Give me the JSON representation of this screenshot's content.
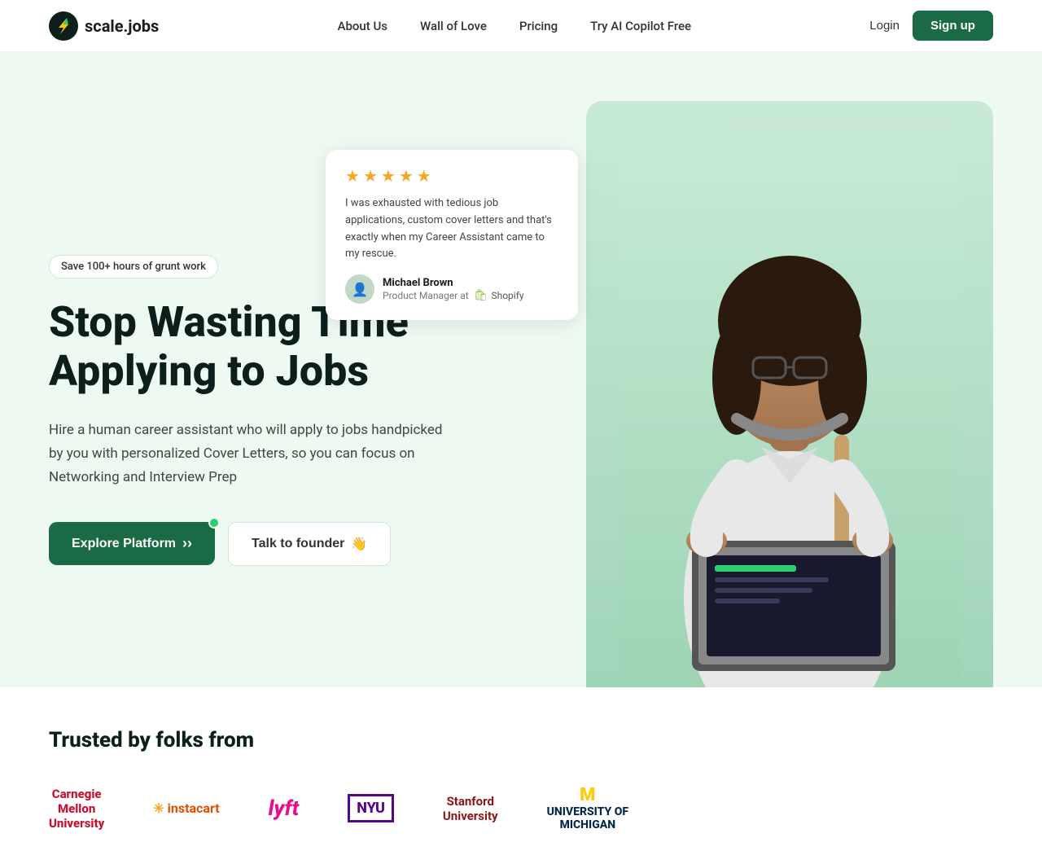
{
  "nav": {
    "logo_text": "scale.jobs",
    "links": [
      {
        "id": "about",
        "label": "About Us",
        "href": "#"
      },
      {
        "id": "wall",
        "label": "Wall of Love",
        "href": "#"
      },
      {
        "id": "pricing",
        "label": "Pricing",
        "href": "#"
      },
      {
        "id": "ai",
        "label": "Try AI Copilot Free",
        "href": "#"
      }
    ],
    "login_label": "Login",
    "signup_label": "Sign up"
  },
  "hero": {
    "badge": "Save 100+ hours of grunt work",
    "title_line1": "Stop Wasting Time",
    "title_line2": "Applying to Jobs",
    "description": "Hire a human career assistant who will apply to jobs handpicked by you with personalized Cover Letters, so you can focus on Networking and Interview Prep",
    "explore_label": "Explore Platform",
    "talk_label": "Talk to founder",
    "talk_emoji": "👋"
  },
  "review": {
    "stars": 5,
    "text": "I was exhausted with tedious job applications, custom cover letters and that's exactly when my Career Assistant came to my rescue.",
    "author_name": "Michael Brown",
    "author_role": "Product Manager at",
    "company": "Shopify"
  },
  "trusted": {
    "title": "Trusted by folks from",
    "logos": [
      {
        "id": "cmu",
        "name": "Carnegie Mellon University"
      },
      {
        "id": "instacart",
        "name": "Instacart"
      },
      {
        "id": "lyft",
        "name": "Lyft"
      },
      {
        "id": "nyu",
        "name": "NYU"
      },
      {
        "id": "stanford",
        "name": "Stanford University"
      },
      {
        "id": "michigan",
        "name": "University of Michigan"
      }
    ]
  }
}
